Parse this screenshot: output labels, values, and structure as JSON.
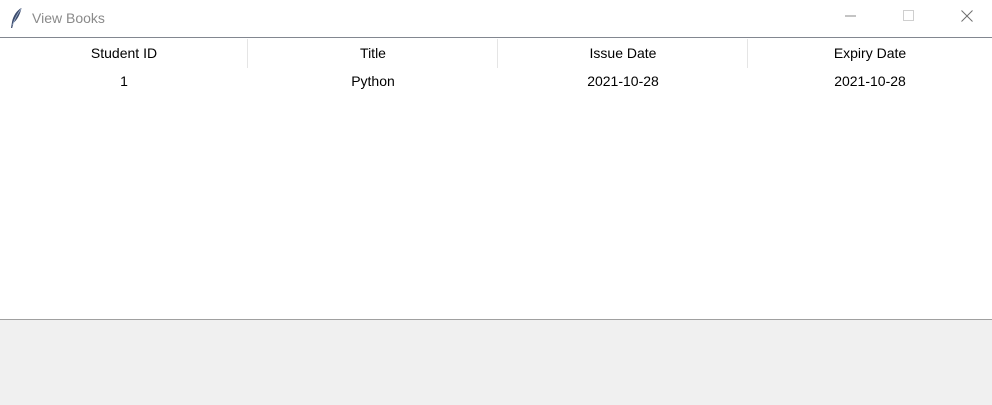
{
  "window": {
    "title": "View Books",
    "icon": "feather-icon"
  },
  "controls": {
    "minimize_icon": "minimize-icon",
    "maximize_icon": "maximize-icon",
    "close_icon": "close-icon"
  },
  "table": {
    "columns": [
      "Student ID",
      "Title",
      "Issue Date",
      "Expiry Date"
    ],
    "rows": [
      [
        "1",
        "Python",
        "2021-10-28",
        "2021-10-28"
      ]
    ]
  },
  "colors": {
    "header_separator": "#e5e5e5",
    "border": "#828790",
    "panel": "#f0f0f0",
    "title_text": "#8a8a8a"
  }
}
